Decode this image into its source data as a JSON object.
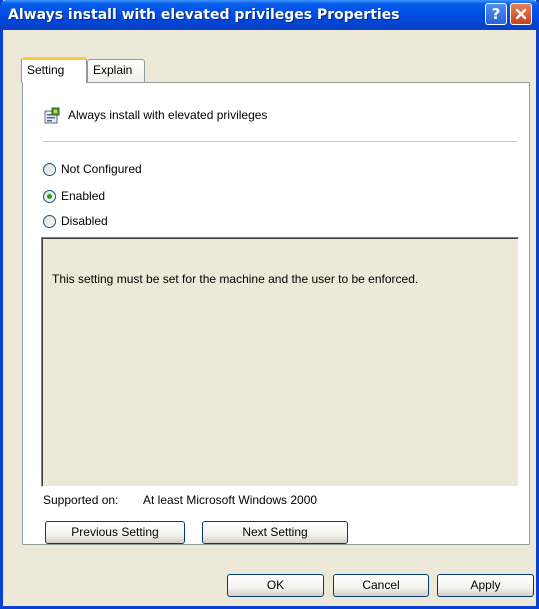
{
  "window": {
    "title": "Always install with elevated privileges Properties",
    "help_glyph": "?",
    "accent_color": "#0050e6"
  },
  "tabs": [
    {
      "label": "Setting",
      "active": true
    },
    {
      "label": "Explain",
      "active": false
    }
  ],
  "policy": {
    "icon": "policy-setting-icon",
    "name": "Always install with elevated privileges"
  },
  "options": [
    {
      "label": "Not Configured",
      "checked": false
    },
    {
      "label": "Enabled",
      "checked": true
    },
    {
      "label": "Disabled",
      "checked": false
    }
  ],
  "description": "This setting must be set for the machine and the user to be enforced.",
  "supported": {
    "label": "Supported on:",
    "value": "At least Microsoft Windows 2000"
  },
  "nav_buttons": {
    "previous": "Previous Setting",
    "next": "Next Setting"
  },
  "dialog_buttons": {
    "ok": "OK",
    "cancel": "Cancel",
    "apply": "Apply"
  }
}
